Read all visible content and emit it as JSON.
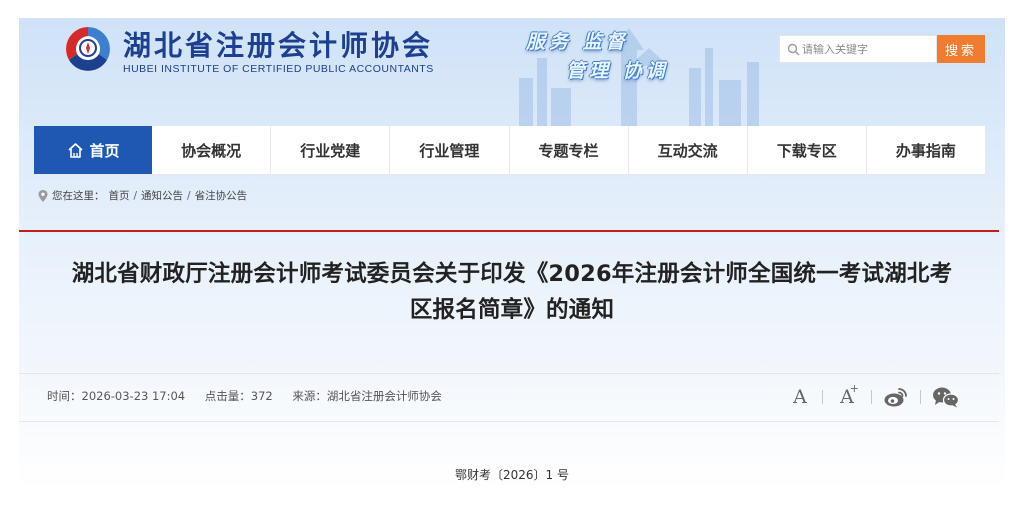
{
  "header": {
    "title": "湖北省注册会计师协会",
    "subtitle": "HUBEI INSTITUTE OF CERTIFIED PUBLIC ACCOUNTANTS",
    "slogan_line1": "服务 监督",
    "slogan_line2": "管理 协调"
  },
  "search": {
    "placeholder": "请输入关键字",
    "button_label": "搜索"
  },
  "nav": {
    "items": [
      {
        "label": "首页",
        "icon": "home-icon",
        "active": true
      },
      {
        "label": "协会概况"
      },
      {
        "label": "行业党建"
      },
      {
        "label": "行业管理"
      },
      {
        "label": "专题专栏"
      },
      {
        "label": "互动交流"
      },
      {
        "label": "下载专区"
      },
      {
        "label": "办事指南"
      }
    ]
  },
  "breadcrumb": {
    "prefix": "您在这里：",
    "items": [
      "首页",
      "通知公告",
      "省注协公告"
    ],
    "separator": "/"
  },
  "article": {
    "title_line1": "湖北省财政厅注册会计师考试委员会关于印发《2026年注册会计师全国统一考试湖北考",
    "title_line2": "区报名简章》的通知",
    "time_label": "时间：2026-03-23 17:04",
    "views_label": "点击量：372",
    "source_label": "来源：湖北省注册会计师协会",
    "doc_number": "鄂财考〔2026〕1 号"
  },
  "tools": {
    "font_decrease": "A",
    "font_increase": "A",
    "font_increase_mark": "+",
    "icons": [
      "font-decrease-icon",
      "font-increase-icon",
      "weibo-icon",
      "wechat-icon"
    ]
  },
  "colors": {
    "brand_blue": "#1f58b3",
    "title_blue": "#1d3f8f",
    "search_orange": "#f07d2f",
    "divider_red": "#c51b1b"
  }
}
